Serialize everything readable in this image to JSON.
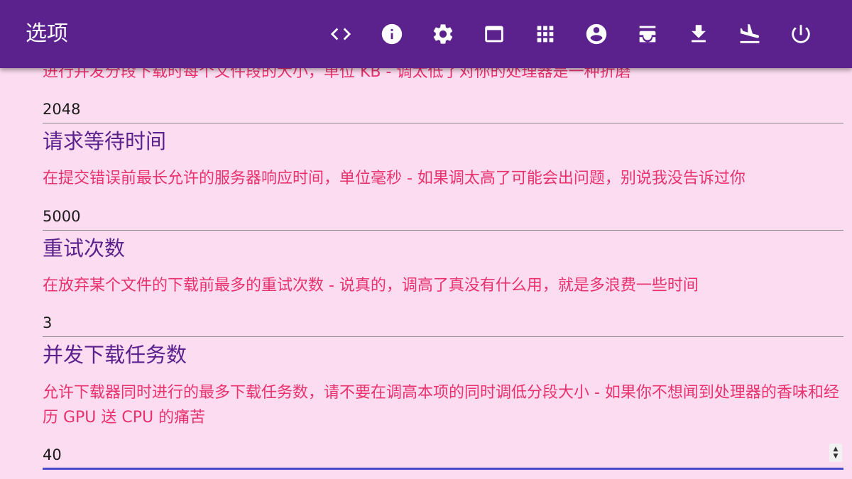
{
  "header": {
    "title": "选项",
    "icons": [
      "code-icon",
      "info-icon",
      "gear-icon",
      "window-icon",
      "grid-icon",
      "account-icon",
      "inbox-icon",
      "download-icon",
      "airplane-landing-icon",
      "power-icon"
    ]
  },
  "colors": {
    "appbar": "#5b218d",
    "background": "#fcdcf0",
    "title": "#5b218d",
    "description": "#e8326e",
    "focus_underline": "#4a4ac8"
  },
  "settings": [
    {
      "title": "",
      "description": "进行并发分段下载时每个文件段的大小，单位 KB - 调太低了对你的处理器是一种折磨",
      "value": "2048"
    },
    {
      "title": "请求等待时间",
      "description": "在提交错误前最长允许的服务器响应时间，单位毫秒 - 如果调太高了可能会出问题，别说我没告诉过你",
      "value": "5000"
    },
    {
      "title": "重试次数",
      "description": "在放弃某个文件的下载前最多的重试次数 - 说真的，调高了真没有什么用，就是多浪费一些时间",
      "value": "3"
    },
    {
      "title": "并发下载任务数",
      "description": "允许下载器同时进行的最多下载任务数，请不要在调高本项的同时调低分段大小 - 如果你不想闻到处理器的香味和经历 GPU 送 CPU 的痛苦",
      "value": "40"
    }
  ]
}
